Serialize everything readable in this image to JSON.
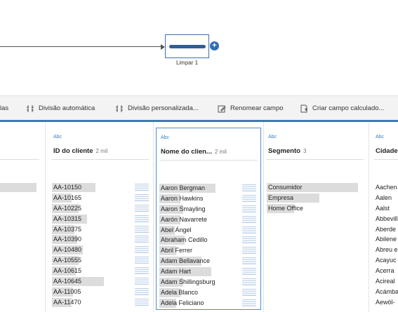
{
  "flow": {
    "step_label": "Limpar 1"
  },
  "toolbar": {
    "items": [
      {
        "label": "las",
        "icon": "partial-icon"
      },
      {
        "label": "Divisão automática",
        "icon": "split-icon"
      },
      {
        "label": "Divisão personalizada...",
        "icon": "split-icon"
      },
      {
        "label": "Renomear campo",
        "icon": "rename-icon"
      },
      {
        "label": "Criar campo calculado...",
        "icon": "calc-icon"
      }
    ]
  },
  "columns": {
    "client_id": {
      "type": "Abc",
      "title": "ID do cliente",
      "count": "2 mil",
      "values": [
        "AA-10150",
        "AA-10165",
        "AA-10225",
        "AA-10315",
        "AA-10375",
        "AA-10390",
        "AA-10480",
        "AA-10555",
        "AA-10615",
        "AA-10645",
        "AA-11005",
        "AA-11470"
      ],
      "bars": [
        0.62,
        0.28,
        0.38,
        0.5,
        0.32,
        0.36,
        0.44,
        0.38,
        0.34,
        0.74,
        0.3,
        0.28
      ]
    },
    "client_name": {
      "type": "Abc",
      "title": "Nome do clien...",
      "count": "2 mil",
      "values": [
        "Aaron Bergman",
        "Aaron Hawkins",
        "Aaron Smayling",
        "Aarón Navarrete",
        "Abel Ángel",
        "Abraham Cedillo",
        "Abril Ferrer",
        "Adam Bellavance",
        "Adam Hart",
        "Adam Shillingsburg",
        "Adela Blanco",
        "Adela Feliciano"
      ],
      "bars": [
        0.8,
        0.3,
        0.34,
        0.3,
        0.22,
        0.36,
        0.24,
        0.6,
        0.74,
        0.34,
        0.3,
        0.24
      ]
    },
    "segment": {
      "type": "Abc",
      "title": "Segmento",
      "count": "3",
      "values": [
        "Consumidor",
        "Empresa",
        "Home Office"
      ],
      "bars": [
        1.0,
        0.58,
        0.3
      ]
    },
    "city": {
      "type": "Abc",
      "title": "Cidade",
      "values": [
        "Aachen",
        "Aalen",
        "Aalst",
        "Abbevill",
        "Aberde",
        "Abilene",
        "Abreu e",
        "Acayuc",
        "Acerra",
        "Acireal",
        "Acámba",
        "Aewöl-"
      ]
    },
    "left_partial": {
      "values": [
        ""
      ]
    }
  },
  "colors": {
    "accent": "#3f78b8",
    "selected_border": "#4a90d9",
    "type_tag": "#3b7bbf"
  }
}
